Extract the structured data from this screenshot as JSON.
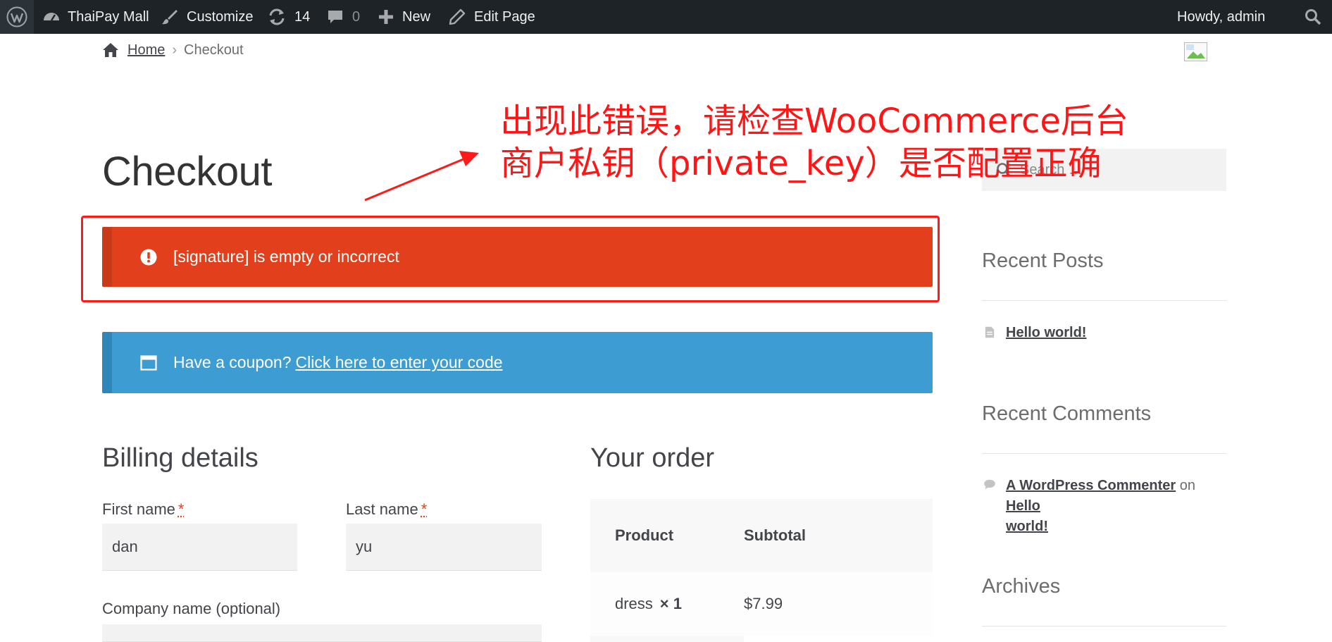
{
  "admin_bar": {
    "site_name": "ThaiPay Mall",
    "customize": "Customize",
    "updates_count": "14",
    "comments_count": "0",
    "new": "New",
    "edit_page": "Edit Page",
    "greeting": "Howdy, admin"
  },
  "breadcrumb": {
    "home": "Home",
    "current": "Checkout"
  },
  "page": {
    "title": "Checkout"
  },
  "annotation": {
    "line1": "出现此错误，请检查WooCommerce后台",
    "line2": "商户私钥（private_key）是否配置正确",
    "color": "#ff1515"
  },
  "notices": {
    "error": "[signature] is empty or incorrect",
    "coupon_prefix": "Have a coupon?",
    "coupon_link": "Click here to enter your code"
  },
  "billing": {
    "heading": "Billing details",
    "first_name_label": "First name",
    "last_name_label": "Last name",
    "required_mark": "*",
    "first_name_value": "dan",
    "last_name_value": "yu",
    "company_label": "Company name (optional)"
  },
  "order": {
    "heading": "Your order",
    "col_product": "Product",
    "col_subtotal": "Subtotal",
    "items": [
      {
        "name": "dress",
        "qty": "× 1",
        "subtotal": "$7.99"
      }
    ]
  },
  "sidebar": {
    "search_placeholder": "Search …",
    "recent_posts_title": "Recent Posts",
    "recent_post": "Hello world!",
    "recent_comments_title": "Recent Comments",
    "comment_author": "A WordPress Commenter",
    "comment_on": "on",
    "comment_post_line1": "Hello",
    "comment_post_line2": "world!",
    "archives_title": "Archives"
  },
  "colors": {
    "admin_bar": "#1d2327",
    "error": "#e2401c",
    "info": "#3d9cd2"
  }
}
